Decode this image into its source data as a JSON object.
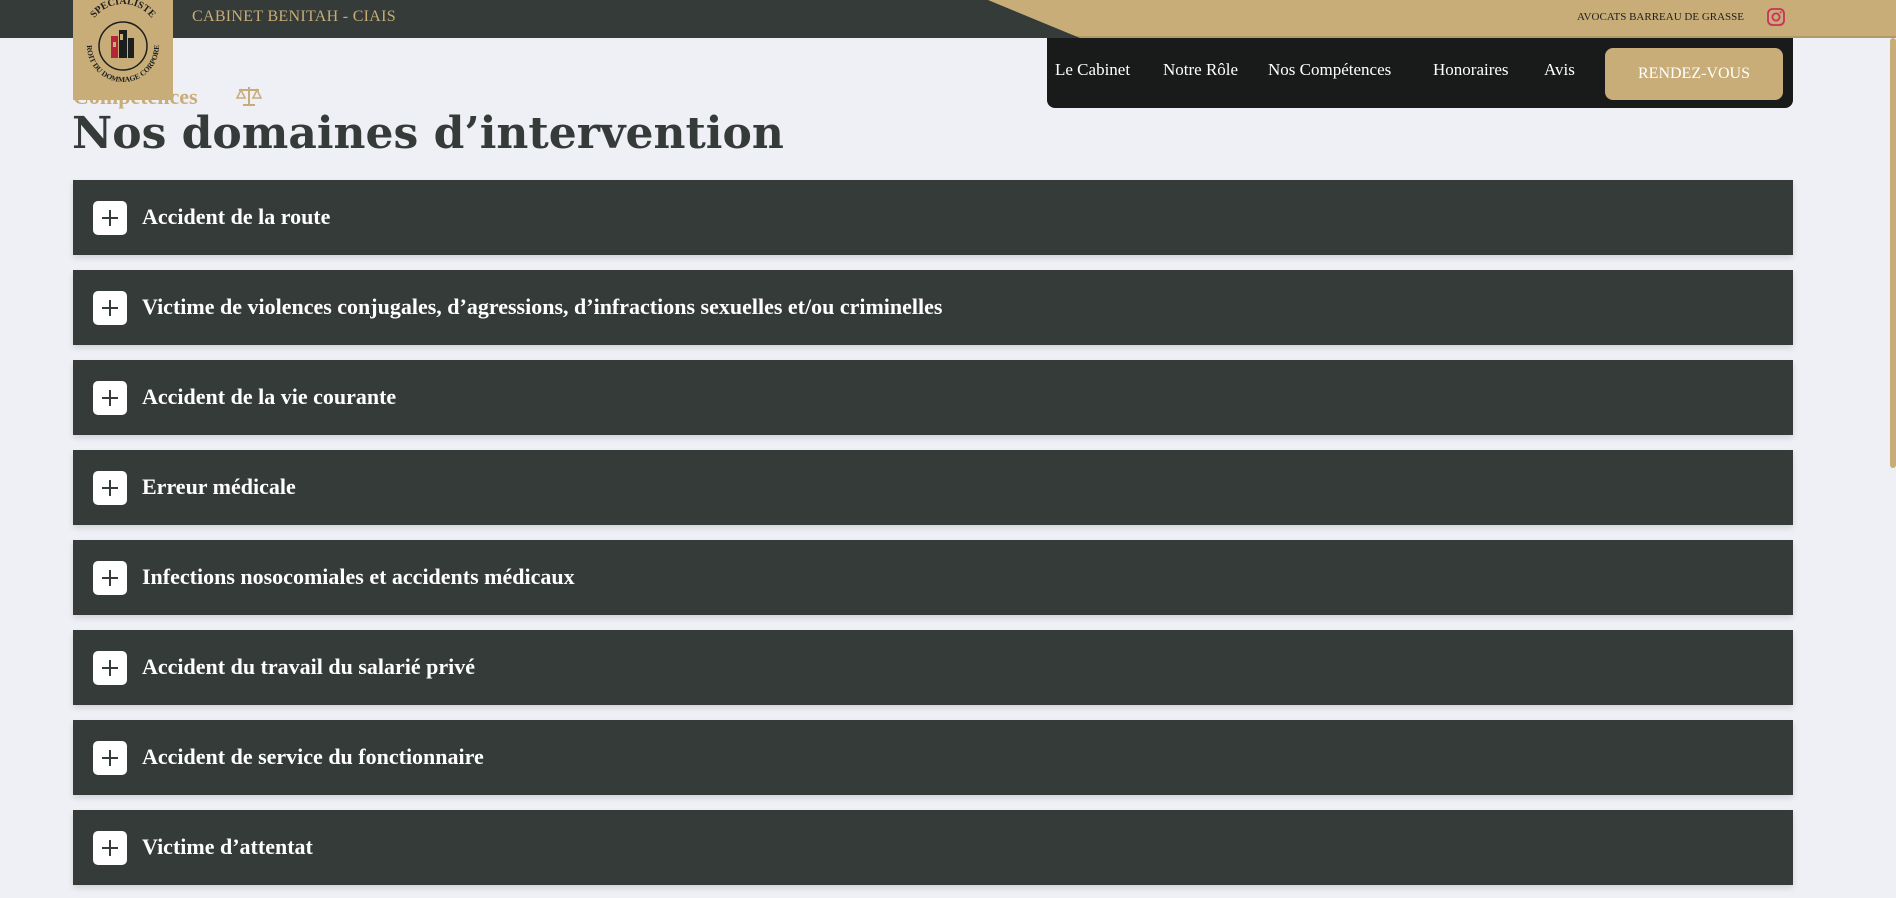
{
  "topbar": {
    "firm_name": "CABINET BENITAH - CIAIS",
    "bar_label": "AVOCATS BARREAU DE GRASSE",
    "instagram_icon": "instagram-icon"
  },
  "logo": {
    "top_text": "SPECIALISTE",
    "ring_text": "DROIT DU DOMMAGE CORPOREL"
  },
  "nav": {
    "items": [
      "Le Cabinet",
      "Notre Rôle",
      "Nos Compétences",
      "Honoraires",
      "Avis"
    ],
    "cta": "RENDEZ-VOUS"
  },
  "section": {
    "eyebrow": "Compétences",
    "eyebrow_icon": "scales-icon",
    "title": "Nos domaines d’intervention"
  },
  "accordion": [
    "Accident de la route",
    "Victime de violences conjugales, d’agressions, d’infractions sexuelles et/ou criminelles",
    "Accident de la vie courante",
    "Erreur médicale",
    "Infections nosocomiales et accidents médicaux",
    "Accident du travail du salarié privé",
    "Accident de service du fonctionnaire",
    "Victime d’attentat"
  ],
  "colors": {
    "gold": "#c8ad78",
    "dark": "#343b38",
    "nav_bg": "#191a1a",
    "page_bg": "#eff0f6"
  }
}
